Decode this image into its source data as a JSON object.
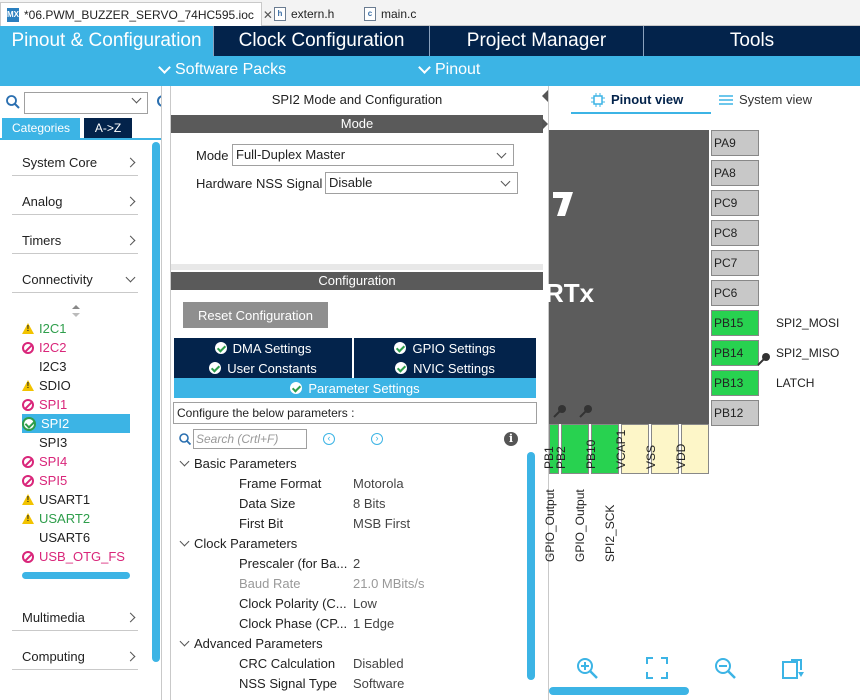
{
  "file_tabs": [
    {
      "label": "*06.PWM_BUZZER_SERVO_74HC595.ioc",
      "icon": "mx-icon",
      "active": true
    },
    {
      "label": "extern.h",
      "icon": "header-file-icon"
    },
    {
      "label": "main.c",
      "icon": "c-file-icon"
    }
  ],
  "main_nav": {
    "tabs": [
      "Pinout & Configuration",
      "Clock Configuration",
      "Project Manager",
      "Tools"
    ],
    "active_index": 0
  },
  "sub_nav": {
    "items": [
      "Software Packs",
      "Pinout"
    ]
  },
  "left_panel": {
    "search_value": "",
    "category_buttons": [
      "Categories",
      "A->Z"
    ],
    "categories_top": [
      "System Core",
      "Analog",
      "Timers",
      "Connectivity"
    ],
    "peripherals": [
      {
        "name": "I2C1",
        "status": "warning",
        "color": "#2e9e4b"
      },
      {
        "name": "I2C2",
        "status": "forbidden",
        "color": "#d9267a"
      },
      {
        "name": "I2C3",
        "status": "none",
        "color": "#222222"
      },
      {
        "name": "SDIO",
        "status": "warning",
        "color": "#222222"
      },
      {
        "name": "SPI1",
        "status": "forbidden",
        "color": "#d9267a"
      },
      {
        "name": "SPI2",
        "status": "ok",
        "color": "#ffffff",
        "selected": true
      },
      {
        "name": "SPI3",
        "status": "none",
        "color": "#222222"
      },
      {
        "name": "SPI4",
        "status": "forbidden",
        "color": "#d9267a"
      },
      {
        "name": "SPI5",
        "status": "forbidden",
        "color": "#d9267a"
      },
      {
        "name": "USART1",
        "status": "warning",
        "color": "#222222"
      },
      {
        "name": "USART2",
        "status": "warning",
        "color": "#2e9e4b"
      },
      {
        "name": "USART6",
        "status": "none",
        "color": "#222222"
      },
      {
        "name": "USB_OTG_FS",
        "status": "forbidden",
        "color": "#d9267a"
      }
    ],
    "categories_bottom": [
      "Multimedia",
      "Computing"
    ]
  },
  "mid_panel": {
    "title": "SPI2 Mode and Configuration",
    "mode_bar": "Mode",
    "mode_label": "Mode",
    "mode_value": "Full-Duplex Master",
    "nss_label": "Hardware NSS Signal",
    "nss_value": "Disable",
    "config_bar": "Configuration",
    "reset_button": "Reset Configuration",
    "config_tabs": [
      "DMA Settings",
      "GPIO Settings",
      "User Constants",
      "NVIC Settings",
      "Parameter Settings"
    ],
    "hint": "Configure the below parameters :",
    "search_placeholder": "Search (Crtl+F)",
    "groups": [
      {
        "name": "Basic Parameters",
        "params": [
          {
            "name": "Frame Format",
            "value": "Motorola"
          },
          {
            "name": "Data Size",
            "value": "8 Bits"
          },
          {
            "name": "First Bit",
            "value": "MSB First"
          }
        ]
      },
      {
        "name": "Clock Parameters",
        "params": [
          {
            "name": "Prescaler (for Ba...",
            "value": "2"
          },
          {
            "name": "Baud Rate",
            "value": "21.0 MBits/s",
            "disabled": true
          },
          {
            "name": "Clock Polarity (C...",
            "value": "Low"
          },
          {
            "name": "Clock Phase (CP...",
            "value": "1 Edge"
          }
        ]
      },
      {
        "name": "Advanced Parameters",
        "params": [
          {
            "name": "CRC Calculation",
            "value": "Disabled"
          },
          {
            "name": "NSS Signal Type",
            "value": "Software"
          }
        ]
      }
    ]
  },
  "right_panel": {
    "view_tabs": [
      "Pinout view",
      "System view"
    ],
    "chip_text": "RTx",
    "right_pins": [
      "PA9",
      "PA8",
      "PC9",
      "PC8",
      "PC7",
      "PC6",
      "PB15",
      "PB14",
      "PB13",
      "PB12"
    ],
    "right_pin_labels": {
      "PB15": "SPI2_MOSI",
      "PB14": "SPI2_MISO",
      "PB13": "LATCH"
    },
    "bottom_pins": [
      "PB1",
      "PB2",
      "PB10",
      "VCAP1",
      "VSS",
      "VDD"
    ],
    "bottom_pin_labels": [
      "GPIO_Output",
      "GPIO_Output",
      "SPI2_SCK"
    ],
    "toolbar_icons": [
      "zoom-in-icon",
      "fit-icon",
      "zoom-out-icon",
      "export-icon"
    ]
  }
}
